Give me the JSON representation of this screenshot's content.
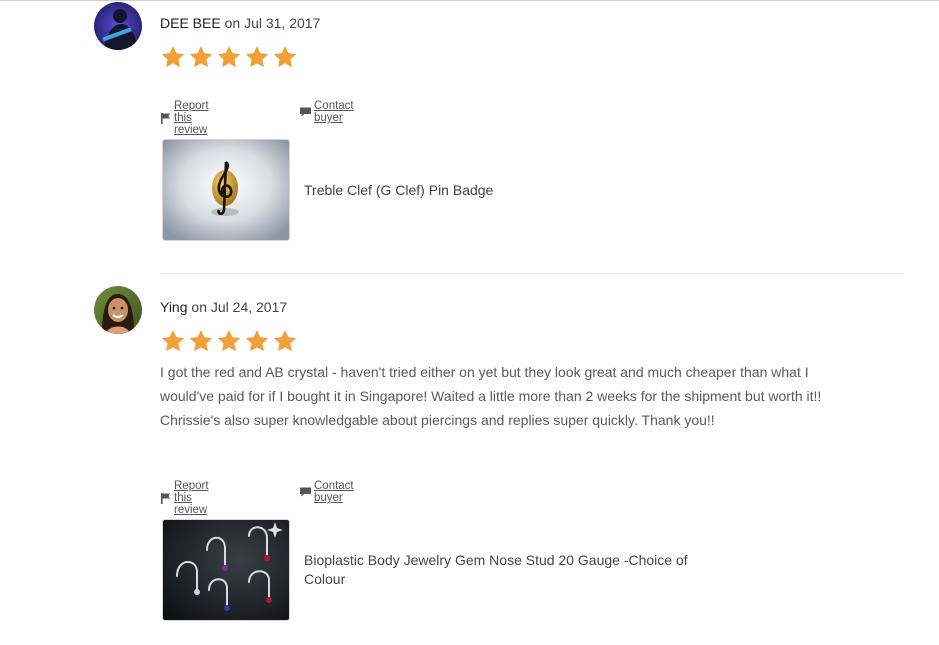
{
  "colors": {
    "star": "#f1a039",
    "divider": "#e1e1e1",
    "text_muted": "#595959"
  },
  "reviews": [
    {
      "name": "DEE BEE",
      "on": "on",
      "date": "Jul 31, 2017",
      "rating": 5,
      "text": "",
      "report_label": "Report this review",
      "contact_label": "Contact buyer",
      "item_title": "Treble Clef (G Clef) Pin Badge",
      "thumb": "treble-clef-pin-image"
    },
    {
      "name": "Ying",
      "on": "on",
      "date": "Jul 24, 2017",
      "rating": 5,
      "text": "I got the red and AB crystal - haven't tried either on yet but they look great and much cheaper than what I would've paid for if I bought it in Singapore! Waited a little more than 2 weeks for the shipment but worth it!! Chrissie's also super knowledgable about piercings and replies super quickly. Thank you!!",
      "report_label": "Report this review",
      "contact_label": "Contact buyer",
      "item_title": "Bioplastic Body Jewelry Gem Nose Stud 20 Gauge -Choice of Colour",
      "thumb": "nose-stud-image"
    }
  ],
  "icons": {
    "star": "star-icon",
    "flag": "flag-icon",
    "message": "message-icon"
  }
}
